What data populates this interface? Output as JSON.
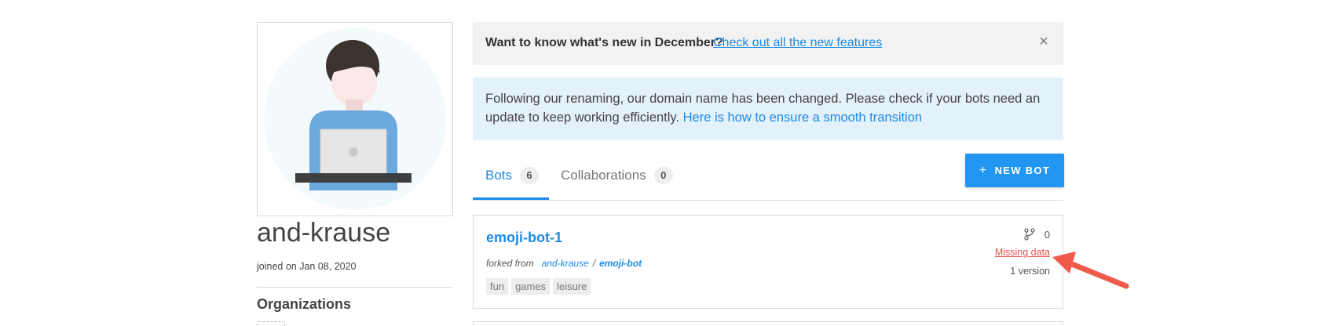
{
  "profile": {
    "avatar_icon": "person-at-laptop-icon",
    "username": "and-krause",
    "joined": "joined on Jan 08, 2020",
    "organizations_title": "Organizations"
  },
  "news_banner": {
    "text": "Want to know what's new in December?",
    "link": "Check out all the new features",
    "close_icon": "close-icon"
  },
  "info_banner": {
    "text": "Following our renaming, our domain name has been changed. Please check if your bots need an update to keep working efficiently.",
    "link": "Here is how to ensure a smooth transition"
  },
  "tabs": [
    {
      "label": "Bots",
      "count": "6",
      "active": true
    },
    {
      "label": "Collaborations",
      "count": "0",
      "active": false
    }
  ],
  "new_bot_button": {
    "icon": "+",
    "label": "NEW BOT"
  },
  "bots": [
    {
      "name": "emoji-bot-1",
      "forked_label": "forked from",
      "forked_owner": "and-krause",
      "forked_sep": "/",
      "forked_repo": "emoji-bot",
      "tags": [
        "fun",
        "games",
        "leisure"
      ],
      "forks": "0",
      "status": "Missing data",
      "versions": "1 version"
    }
  ],
  "colors": {
    "accent": "#2196f3",
    "link": "#1a8be8",
    "error": "#e5534b",
    "annotation_arrow": "#ef5a4a"
  }
}
